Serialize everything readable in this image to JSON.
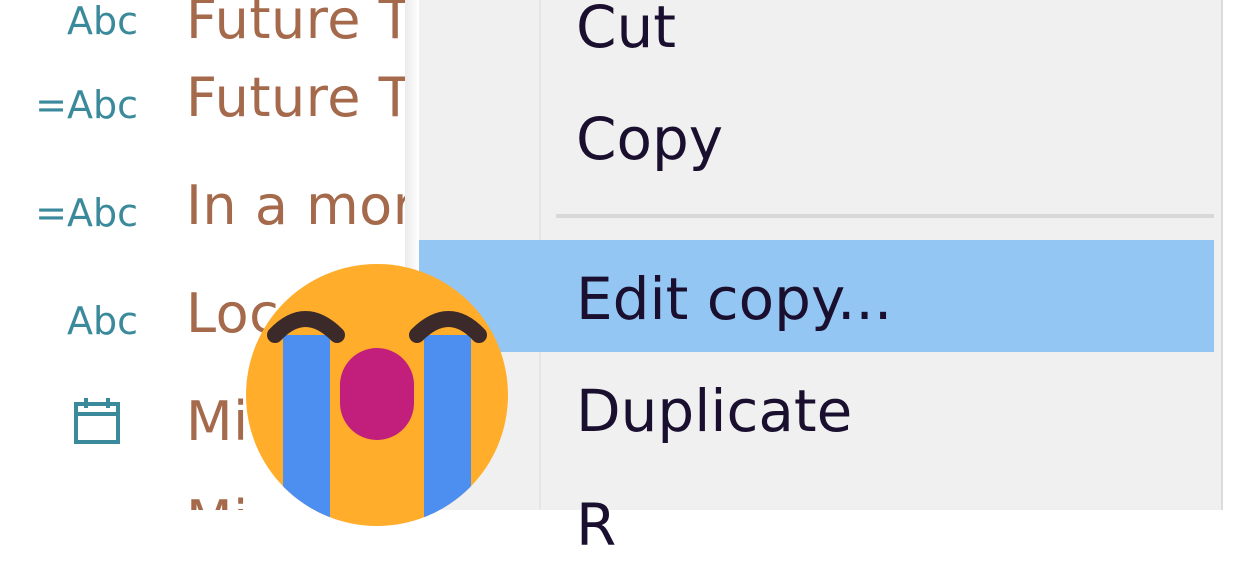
{
  "list": {
    "rows": [
      {
        "type_label": "Abc",
        "name": "Future T"
      },
      {
        "type_label": "=Abc",
        "name": "Future T"
      },
      {
        "type_label": "=Abc",
        "name": "In a mor"
      },
      {
        "type_label": "Abc",
        "name": "Loc"
      },
      {
        "type_icon": "calendar-icon",
        "name": "Mi"
      },
      {
        "type_label": "",
        "name": "Mi"
      }
    ]
  },
  "context_menu": {
    "items": [
      "Cut",
      "Copy",
      "Edit copy...",
      "Duplicate",
      "R"
    ],
    "highlighted": "Edit copy..."
  },
  "overlay": {
    "emoji": "loudly-crying-face-icon"
  },
  "colors": {
    "type_icon": "#3a8a9c",
    "field_name": "#a56a4c",
    "menu_bg": "#f0f0f0",
    "menu_highlight": "#93c6f2",
    "menu_text": "#1a0f2e"
  }
}
